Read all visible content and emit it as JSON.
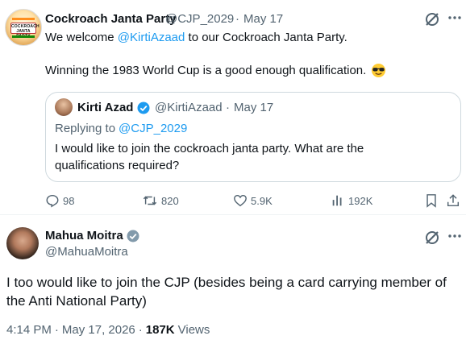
{
  "tweet1": {
    "author_name": "Cockroach Janta Party",
    "handle": "@CJP_2029",
    "separator": "·",
    "date": "May 17",
    "mention": "@KirtiAzaad",
    "line1_prefix": "We welcome",
    "line1_suffix": "to our Cockroach Janta Party.",
    "line2": "Winning the 1983 World Cup is a good enough qualification.",
    "avatar_text": "COCKROACH JANTA PARTY",
    "quote": {
      "author_name": "Kirti Azad",
      "handle": "@KirtiAzaad",
      "separator": "·",
      "date": "May 17",
      "replying_label": "Replying to",
      "replying_handle": "@CJP_2029",
      "text_line1": "I would like to join the cockroach janta party. What are the",
      "text_line2": "qualifications required?"
    },
    "actions": {
      "replies": "98",
      "reposts": "820",
      "likes": "5.9K",
      "views": "192K"
    }
  },
  "tweet2": {
    "author_name": "Mahua Moitra",
    "handle": "@MahuaMoitra",
    "text_line1": "I too would like to join the CJP (besides being a card carrying member of",
    "text_line2": "the Anti National Party)",
    "time": "4:14 PM",
    "separator": "·",
    "date": "May 17, 2026",
    "views_count": "187K",
    "views_label": "Views"
  },
  "colors": {
    "accent": "#1d9bf0",
    "muted": "#536471",
    "text": "#0f1419",
    "border": "#cfd9de"
  }
}
